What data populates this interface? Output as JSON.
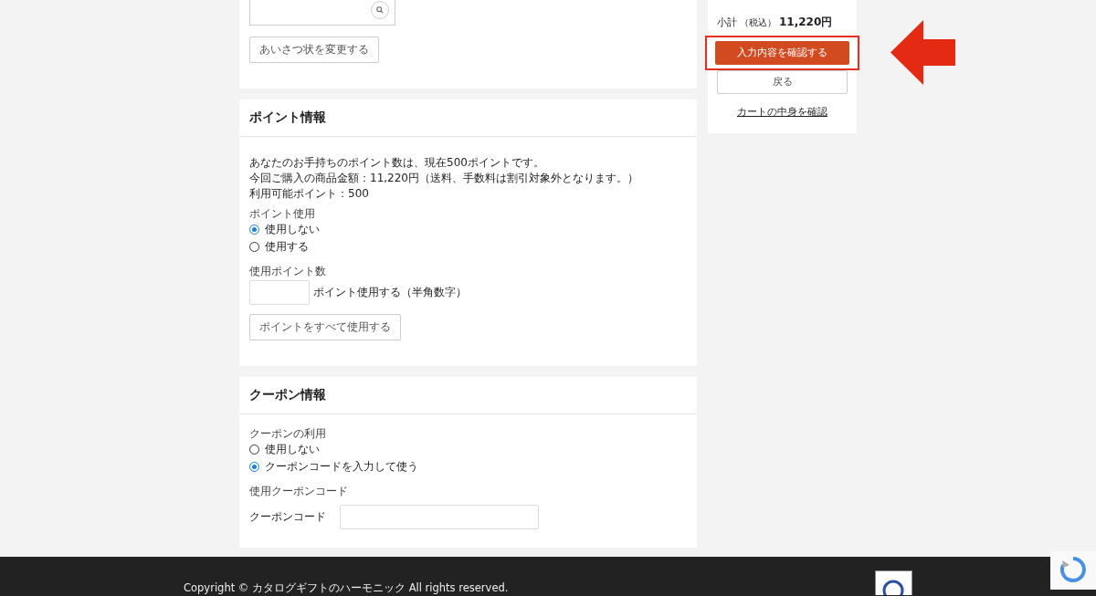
{
  "greeting": {
    "button": "あいさつ状を変更する"
  },
  "points": {
    "title": "ポイント情報",
    "lines": [
      "あなたのお手持ちのポイント数は、現在500ポイントです。",
      "今回ご購入の商品金額：11,220円（送料、手数料は割引対象外となります。）",
      "利用可能ポイント：500"
    ],
    "use_label": "ポイント使用",
    "options": [
      {
        "label": "使用しない",
        "selected": true
      },
      {
        "label": "使用する",
        "selected": false
      }
    ],
    "amount_label": "使用ポイント数",
    "amount_suffix": "ポイント使用する（半角数字）",
    "use_all_button": "ポイントをすべて使用する"
  },
  "coupon": {
    "title": "クーポン情報",
    "use_label": "クーポンの利用",
    "options": [
      {
        "label": "使用しない",
        "selected": false
      },
      {
        "label": "クーポンコードを入力して使う",
        "selected": true
      }
    ],
    "code_section": "使用クーポンコード",
    "code_label": "クーポンコード"
  },
  "summary": {
    "subtotal_label": "小計",
    "tax_note": "（税込）",
    "subtotal": "11,220円",
    "confirm_button": "入力内容を確認する",
    "back_button": "戻る",
    "cart_link": "カートの中身を確認"
  },
  "footer": {
    "copyright": "Copyright © カタログギフトのハーモニック All rights reserved."
  }
}
